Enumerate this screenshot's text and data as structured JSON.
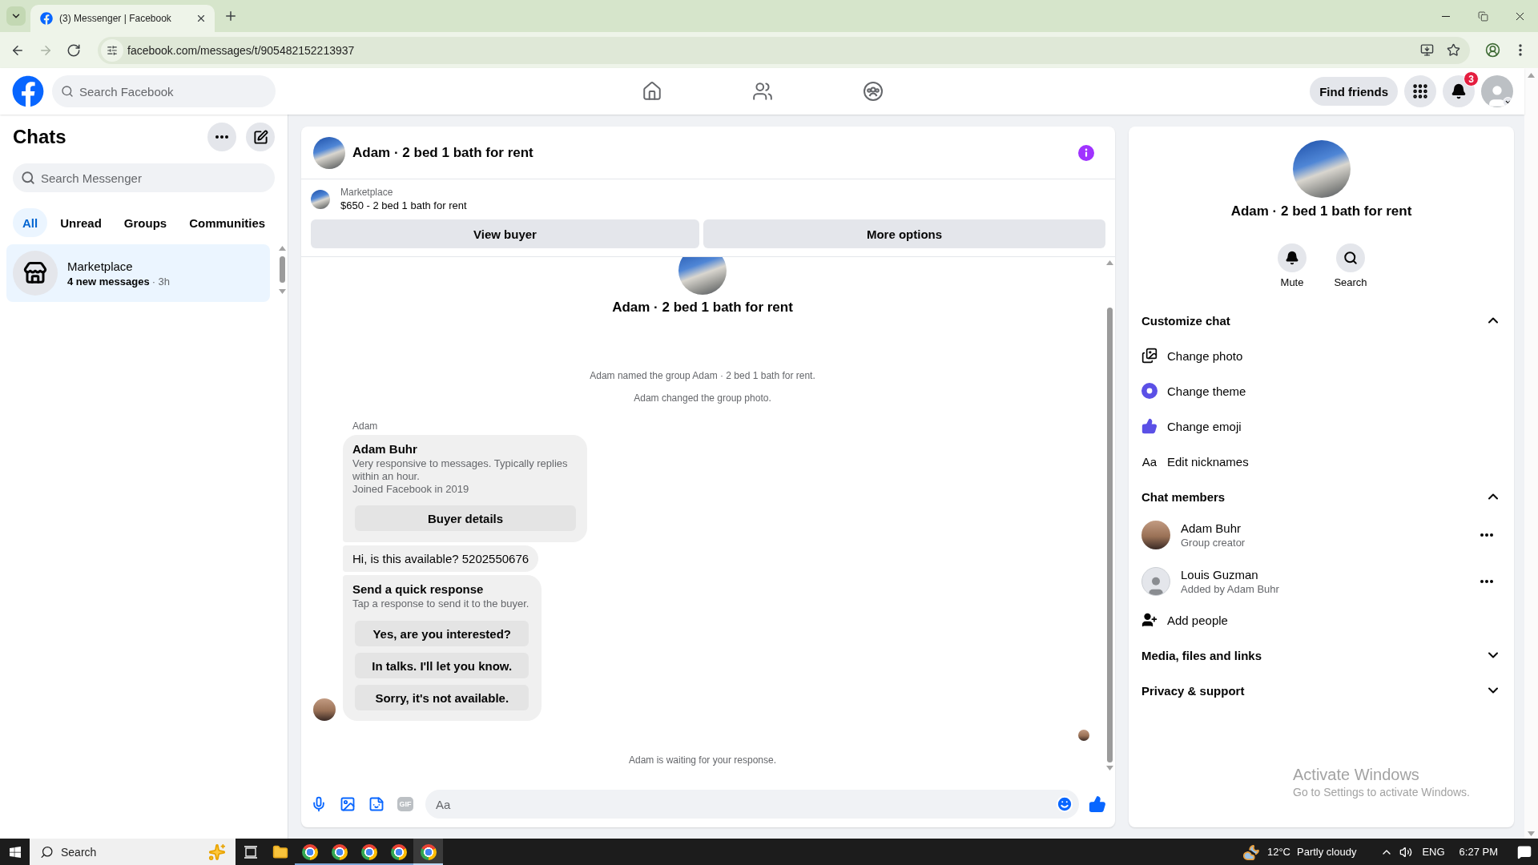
{
  "browser": {
    "tab": {
      "title": "(3) Messenger | Facebook"
    },
    "nav": [
      {
        "kind": "back",
        "disabled": false
      },
      {
        "kind": "forward",
        "disabled": true
      },
      {
        "kind": "reload",
        "disabled": false
      }
    ],
    "url": "facebook.com/messages/t/905482152213937"
  },
  "header": {
    "search": {
      "placeholder": "Search Facebook"
    },
    "nav": [
      {
        "kind": "home"
      },
      {
        "kind": "friends"
      },
      {
        "kind": "groups"
      }
    ],
    "find_friends": "Find friends",
    "notifications_badge": "3"
  },
  "sidebar": {
    "title": "Chats",
    "search": {
      "placeholder": "Search Messenger"
    },
    "filters": [
      {
        "label": "All",
        "selected": true
      },
      {
        "label": "Unread",
        "selected": false
      },
      {
        "label": "Groups",
        "selected": false
      },
      {
        "label": "Communities",
        "selected": false
      }
    ],
    "chats": [
      {
        "name": "Marketplace",
        "preview": "4 new messages",
        "time": "· 3h",
        "selected": true
      }
    ]
  },
  "conversation": {
    "title": "Adam · 2 bed 1 bath for rent",
    "listing": {
      "source": "Marketplace",
      "title": "$650 - 2 bed 1 bath for rent"
    },
    "actions": [
      "View buyer",
      "More options"
    ],
    "group_title": "Adam · 2 bed 1 bath for rent",
    "events": [
      "Adam named the group Adam · 2 bed 1 bath for rent.",
      "Adam changed the group photo."
    ],
    "sender": "Adam",
    "messages": [
      {
        "kind": "profile_card",
        "name": "Adam Buhr",
        "lines": [
          "Very responsive to messages. Typically replies within an hour.",
          "Joined Facebook in 2019"
        ],
        "button": "Buyer details"
      },
      {
        "kind": "text",
        "text": "Hi, is this available? 5202550676"
      },
      {
        "kind": "quick_replies",
        "title": "Send a quick response",
        "subtitle": "Tap a response to send it to the buyer.",
        "options": [
          "Yes, are you interested?",
          "In talks. I'll let you know.",
          "Sorry, it's not available."
        ]
      }
    ],
    "status": "Adam is waiting for your response.",
    "composer": {
      "tools": [
        {
          "kind": "mic"
        },
        {
          "kind": "image"
        },
        {
          "kind": "sticker"
        },
        {
          "kind": "gif",
          "label": "GIF"
        }
      ],
      "placeholder": "Aa"
    }
  },
  "details": {
    "title": "Adam · 2 bed 1 bath for rent",
    "actions": [
      {
        "kind": "bell",
        "label": "Mute"
      },
      {
        "kind": "search",
        "label": "Search"
      }
    ],
    "sections": [
      {
        "title": "Customize chat",
        "expanded": true,
        "rows": [
          {
            "kind": "photo",
            "label": "Change photo"
          },
          {
            "kind": "theme",
            "label": "Change theme"
          },
          {
            "kind": "emoji",
            "label": "Change emoji"
          },
          {
            "kind": "glyph",
            "glyph": "Aa",
            "label": "Edit nicknames"
          }
        ]
      },
      {
        "title": "Chat members",
        "expanded": true,
        "rows": [
          {
            "kind": "member",
            "avatar": {
              "kind": "photo"
            },
            "name": "Adam Buhr",
            "role": "Group creator"
          },
          {
            "kind": "member",
            "avatar": {
              "kind": "silhouette"
            },
            "name": "Louis Guzman",
            "role": "Added by Adam Buhr"
          },
          {
            "kind": "add_person",
            "label": "Add people"
          }
        ]
      },
      {
        "title": "Media, files and links",
        "expanded": false
      },
      {
        "title": "Privacy & support",
        "expanded": false
      }
    ]
  },
  "os": {
    "activation": {
      "title": "Activate Windows",
      "subtitle": "Go to Settings to activate Windows."
    },
    "taskbar": {
      "search": {
        "placeholder": "Search"
      },
      "apps": [
        {
          "kind": "task_view",
          "selected": false
        },
        {
          "kind": "explorer",
          "selected": false
        },
        {
          "kind": "chrome",
          "selected": false
        },
        {
          "kind": "chrome",
          "selected": false
        },
        {
          "kind": "chrome",
          "selected": false
        },
        {
          "kind": "chrome",
          "selected": false
        },
        {
          "kind": "chrome",
          "selected": true
        }
      ],
      "weather": {
        "temperature": "12°C",
        "summary": "Partly cloudy"
      },
      "language": "ENG",
      "time": "6:27 PM"
    }
  }
}
